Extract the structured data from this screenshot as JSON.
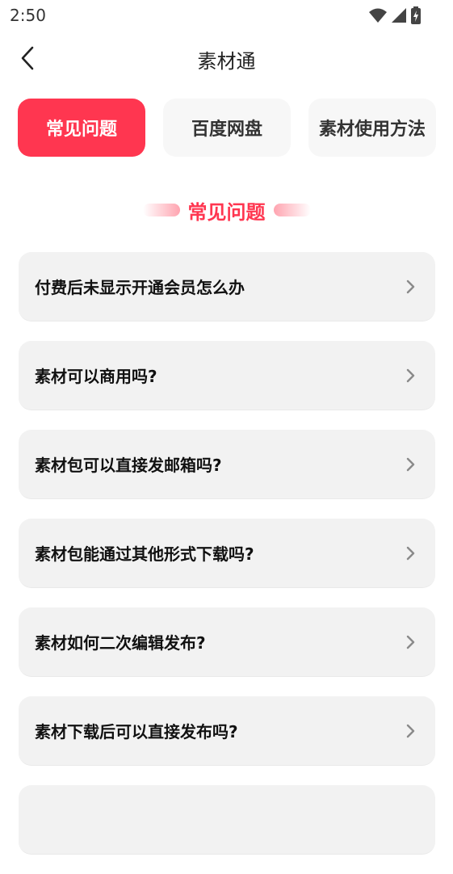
{
  "status_bar": {
    "time": "2:50"
  },
  "header": {
    "title": "素材通"
  },
  "tabs": [
    {
      "label": "常见问题",
      "active": true
    },
    {
      "label": "百度网盘",
      "active": false
    },
    {
      "label": "素材使用方法",
      "active": false
    }
  ],
  "section": {
    "title": "常见问题"
  },
  "faq": [
    {
      "question": "付费后未显示开通会员怎么办"
    },
    {
      "question": "素材可以商用吗?"
    },
    {
      "question": "素材包可以直接发邮箱吗?"
    },
    {
      "question": "素材包能通过其他形式下载吗?"
    },
    {
      "question": "素材如何二次编辑发布?"
    },
    {
      "question": "素材下载后可以直接发布吗?"
    },
    {
      "question": ""
    }
  ],
  "colors": {
    "accent": "#ff3650",
    "card": "#f2f2f2",
    "tab_bg": "#f7f7f7"
  }
}
